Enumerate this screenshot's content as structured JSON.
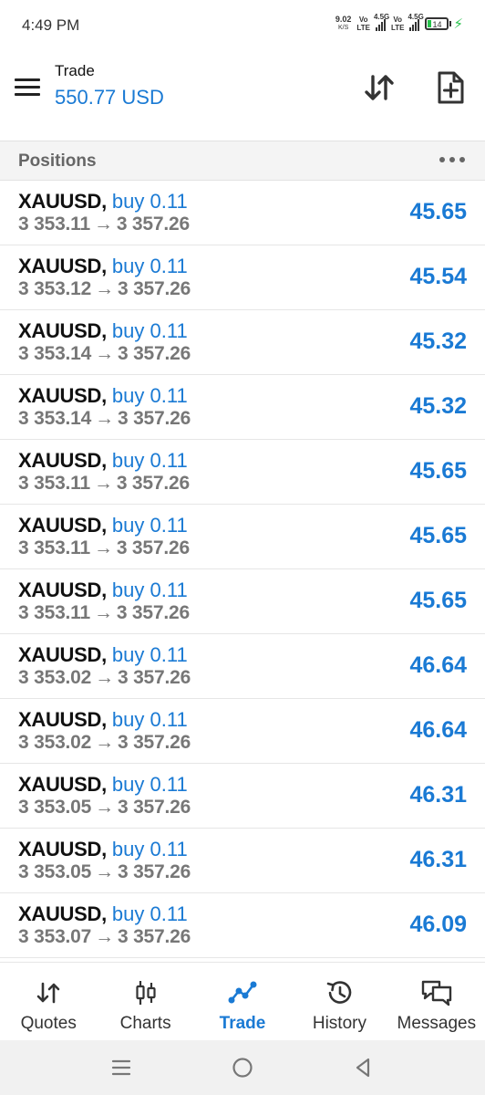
{
  "status_bar": {
    "time": "4:49 PM",
    "speed_value": "9.02",
    "speed_unit": "K/S",
    "volte1_top": "Vo",
    "volte1_bottom": "LTE",
    "net1": "4.5G",
    "volte2_top": "Vo",
    "volte2_bottom": "LTE",
    "net2": "4.5G",
    "battery": "14"
  },
  "header": {
    "title": "Trade",
    "balance": "550.77 USD"
  },
  "positions": {
    "label": "Positions",
    "rows": [
      {
        "symbol": "XAUUSD,",
        "direction": "buy 0.11",
        "open": "3 353.11",
        "arrow": "→",
        "current": "3 357.26",
        "profit": "45.65"
      },
      {
        "symbol": "XAUUSD,",
        "direction": "buy 0.11",
        "open": "3 353.12",
        "arrow": "→",
        "current": "3 357.26",
        "profit": "45.54"
      },
      {
        "symbol": "XAUUSD,",
        "direction": "buy 0.11",
        "open": "3 353.14",
        "arrow": "→",
        "current": "3 357.26",
        "profit": "45.32"
      },
      {
        "symbol": "XAUUSD,",
        "direction": "buy 0.11",
        "open": "3 353.14",
        "arrow": "→",
        "current": "3 357.26",
        "profit": "45.32"
      },
      {
        "symbol": "XAUUSD,",
        "direction": "buy 0.11",
        "open": "3 353.11",
        "arrow": "→",
        "current": "3 357.26",
        "profit": "45.65"
      },
      {
        "symbol": "XAUUSD,",
        "direction": "buy 0.11",
        "open": "3 353.11",
        "arrow": "→",
        "current": "3 357.26",
        "profit": "45.65"
      },
      {
        "symbol": "XAUUSD,",
        "direction": "buy 0.11",
        "open": "3 353.11",
        "arrow": "→",
        "current": "3 357.26",
        "profit": "45.65"
      },
      {
        "symbol": "XAUUSD,",
        "direction": "buy 0.11",
        "open": "3 353.02",
        "arrow": "→",
        "current": "3 357.26",
        "profit": "46.64"
      },
      {
        "symbol": "XAUUSD,",
        "direction": "buy 0.11",
        "open": "3 353.02",
        "arrow": "→",
        "current": "3 357.26",
        "profit": "46.64"
      },
      {
        "symbol": "XAUUSD,",
        "direction": "buy 0.11",
        "open": "3 353.05",
        "arrow": "→",
        "current": "3 357.26",
        "profit": "46.31"
      },
      {
        "symbol": "XAUUSD,",
        "direction": "buy 0.11",
        "open": "3 353.05",
        "arrow": "→",
        "current": "3 357.26",
        "profit": "46.31"
      },
      {
        "symbol": "XAUUSD,",
        "direction": "buy 0.11",
        "open": "3 353.07",
        "arrow": "→",
        "current": "3 357.26",
        "profit": "46.09"
      }
    ]
  },
  "tabs": [
    {
      "label": "Quotes",
      "icon": "quotes-icon",
      "active": false
    },
    {
      "label": "Charts",
      "icon": "charts-icon",
      "active": false
    },
    {
      "label": "Trade",
      "icon": "trade-icon",
      "active": true
    },
    {
      "label": "History",
      "icon": "history-icon",
      "active": false
    },
    {
      "label": "Messages",
      "icon": "messages-icon",
      "active": false
    }
  ],
  "colors": {
    "accent": "#1a7ad4",
    "profit": "#1a7ad4",
    "muted_text": "#777777",
    "section_bg": "#f4f4f4",
    "battery_green": "#27c24c"
  },
  "icons": {
    "menu": "hamburger-menu-icon",
    "sort": "sort-arrows-icon",
    "new_order": "new-document-icon",
    "more": "more-dots-icon",
    "nav_recent": "recents-icon",
    "nav_home": "home-circle-icon",
    "nav_back": "back-triangle-icon"
  }
}
